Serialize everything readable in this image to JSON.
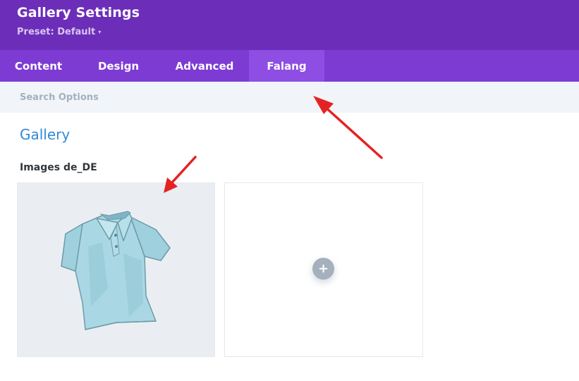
{
  "header": {
    "title": "Gallery Settings",
    "preset_label": "Preset: Default",
    "preset_caret": "▾"
  },
  "tabs": [
    {
      "label": "Content"
    },
    {
      "label": "Design"
    },
    {
      "label": "Advanced"
    },
    {
      "label": "Falang",
      "active": true
    }
  ],
  "search": {
    "placeholder": "Search Options"
  },
  "section": {
    "title": "Gallery"
  },
  "field": {
    "label": "Images de_DE",
    "add_symbol": "+"
  },
  "icons": {
    "image": "polo-shirt-image",
    "add": "plus-icon",
    "annotation": "red-arrow"
  },
  "colors": {
    "header_bg": "#6c2eb9",
    "tabs_bg": "#7d3bd4",
    "active_tab_bg": "#8e4de3",
    "section_title": "#2e8bd8",
    "annotation_arrow": "#e52222"
  }
}
